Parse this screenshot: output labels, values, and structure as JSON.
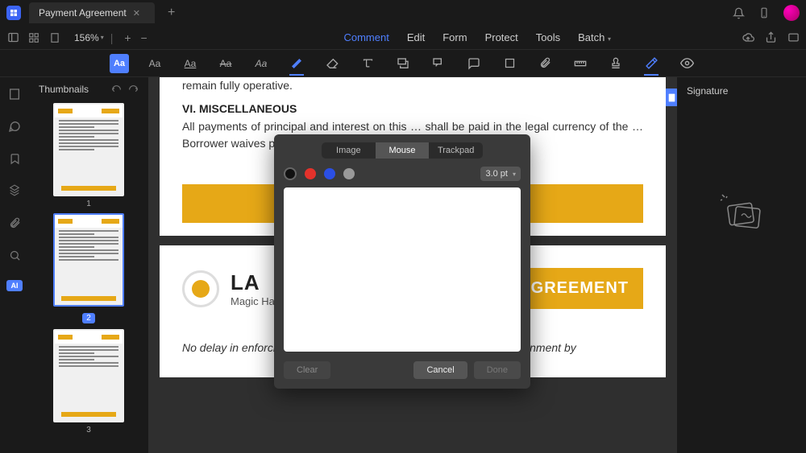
{
  "titlebar": {
    "tab_title": "Payment Agreement"
  },
  "secbar": {
    "zoom": "156%",
    "menus": [
      "Comment",
      "Edit",
      "Form",
      "Protect",
      "Tools",
      "Batch"
    ]
  },
  "thumbs": {
    "title": "Thumbnails",
    "pages": [
      "1",
      "2",
      "3"
    ]
  },
  "rightpanel": {
    "title": "Signature"
  },
  "doc": {
    "p1_line1": "remain fully operative.",
    "p1_h": "VI. MISCELLANEOUS",
    "p1_body": "All payments of principal and interest on this … shall be paid in the legal currency of the … Borrower waives presentment for payment, protest, and no…",
    "p2_lar": "LA",
    "p2_sub": "Magic Happens With Content",
    "p2_badge": "…GREEMENT",
    "p2_text": "No delay in enforcing any right of the Lender under this Note, or assignment by"
  },
  "modal": {
    "tabs": [
      "Image",
      "Mouse",
      "Trackpad"
    ],
    "pt": "3.0 pt",
    "btn_clear": "Clear",
    "btn_cancel": "Cancel",
    "btn_done": "Done"
  }
}
